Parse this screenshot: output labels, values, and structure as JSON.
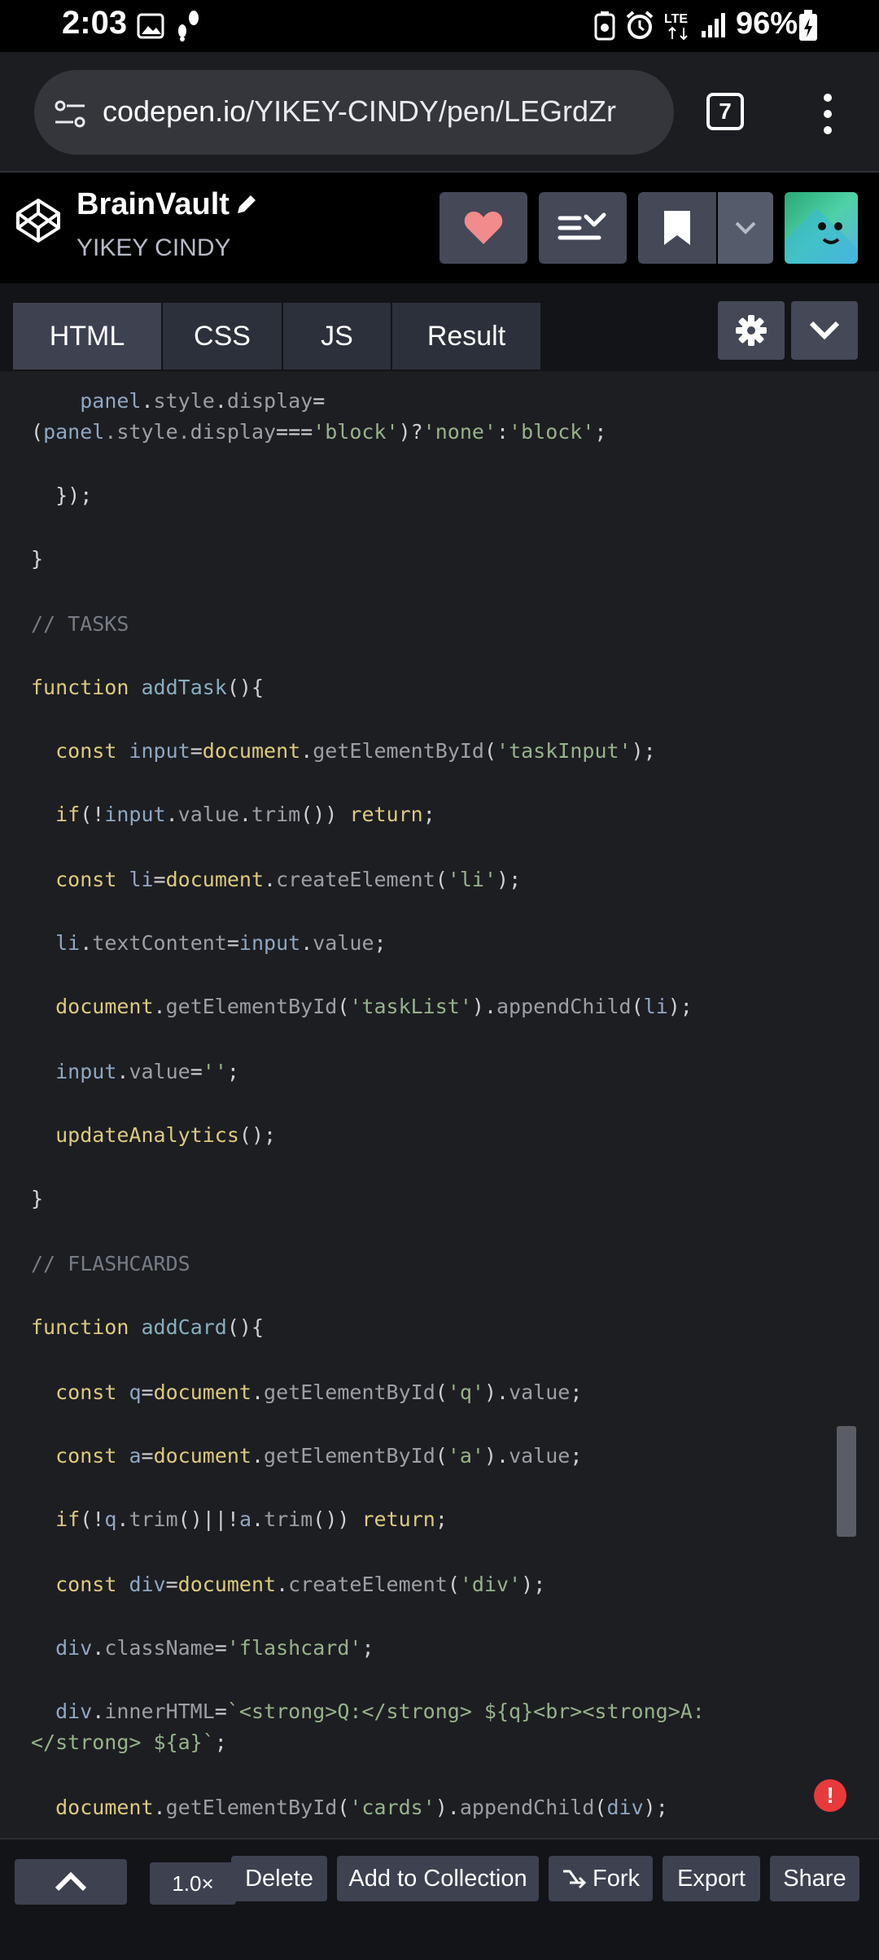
{
  "status_bar": {
    "time": "2:03",
    "battery": "96%"
  },
  "browser": {
    "url_host": "codepen.io",
    "url_path": "/YIKEY-CINDY/pen/LEGrdZr",
    "tab_count": "7"
  },
  "pen": {
    "title": "BrainVault",
    "author": "YIKEY CINDY"
  },
  "editor_tabs": [
    "HTML",
    "CSS",
    "JS",
    "Result"
  ],
  "code": {
    "l1_panel": "panel",
    "l1_dot": ".",
    "l1_style": "style",
    "l1_dot2": ".",
    "l1_display": "display",
    "l1_eq": "=",
    "l2_open": "(",
    "l2_panel": "panel",
    "l2_style": ".style.display",
    "l2_eq": "===",
    "l2_block": "'block'",
    "l2_q": ")?",
    "l2_none": "'none'",
    "l2_colon": ":",
    "l2_block2": "'block'",
    "l2_end": ";",
    "l3": "  });",
    "l4": "}",
    "l5": "// TASKS",
    "l6_kw": "function",
    "l6_fn": "addTask",
    "l6_end": "(){",
    "l7_kw": "const",
    "l7_var": "input",
    "l7_eq": "=",
    "l7_doc": "document",
    "l7_dot": ".",
    "l7_m": "getElementById",
    "l7_open": "(",
    "l7_str": "'taskInput'",
    "l7_end": ");",
    "l8_kw": "if",
    "l8_a": "(!",
    "l8_var": "input",
    "l8_dot": ".",
    "l8_p": "value",
    "l8_dot2": ".",
    "l8_m": "trim",
    "l8_b": "()) ",
    "l8_ret": "return",
    "l8_end": ";",
    "l9_kw": "const",
    "l9_var": "li",
    "l9_eq": "=",
    "l9_doc": "document",
    "l9_dot": ".",
    "l9_m": "createElement",
    "l9_open": "(",
    "l9_str": "'li'",
    "l9_end": ");",
    "l10_var": "li",
    "l10_dot": ".",
    "l10_p": "textContent",
    "l10_eq": "=",
    "l10_var2": "input",
    "l10_dot2": ".",
    "l10_p2": "value",
    "l10_end": ";",
    "l11_doc": "document",
    "l11_dot": ".",
    "l11_m": "getElementById",
    "l11_open": "(",
    "l11_str": "'taskList'",
    "l11_close": ").",
    "l11_m2": "appendChild",
    "l11_open2": "(",
    "l11_var": "li",
    "l11_end": ");",
    "l12_var": "input",
    "l12_dot": ".",
    "l12_p": "value",
    "l12_eq": "=",
    "l12_str": "''",
    "l12_end": ";",
    "l13_fn": "updateAnalytics",
    "l13_end": "();",
    "l14": "}",
    "l15": "// FLASHCARDS",
    "l16_kw": "function",
    "l16_fn": "addCard",
    "l16_end": "(){",
    "l17_kw": "const",
    "l17_var": "q",
    "l17_eq": "=",
    "l17_doc": "document",
    "l17_dot": ".",
    "l17_m": "getElementById",
    "l17_open": "(",
    "l17_str": "'q'",
    "l17_close": ").",
    "l17_p": "value",
    "l17_end": ";",
    "l18_kw": "const",
    "l18_var": "a",
    "l18_eq": "=",
    "l18_doc": "document",
    "l18_dot": ".",
    "l18_m": "getElementById",
    "l18_open": "(",
    "l18_str": "'a'",
    "l18_close": ").",
    "l18_p": "value",
    "l18_end": ";",
    "l19_kw": "if",
    "l19_a": "(!",
    "l19_var": "q",
    "l19_dot": ".",
    "l19_m": "trim",
    "l19_b": "()||!",
    "l19_var2": "a",
    "l19_dot2": ".",
    "l19_m2": "trim",
    "l19_c": "()) ",
    "l19_ret": "return",
    "l19_end": ";",
    "l20_kw": "const",
    "l20_var": "div",
    "l20_eq": "=",
    "l20_doc": "document",
    "l20_dot": ".",
    "l20_m": "createElement",
    "l20_open": "(",
    "l20_str": "'div'",
    "l20_end": ");",
    "l21_var": "div",
    "l21_dot": ".",
    "l21_p": "className",
    "l21_eq": "=",
    "l21_str": "'flashcard'",
    "l21_end": ";",
    "l22_var": "div",
    "l22_dot": ".",
    "l22_p": "innerHTML",
    "l22_eq": "=",
    "l22_str": "`<strong>Q:</strong> ${q}<br><strong>A:",
    "l23_str": "</strong> ${a}`",
    "l23_end": ";",
    "l24_doc": "document",
    "l24_dot": ".",
    "l24_m": "getElementById",
    "l24_open": "(",
    "l24_str": "'cards'",
    "l24_close": ").",
    "l24_m2": "appendChild",
    "l24_open2": "(",
    "l24_var": "div",
    "l24_end": ");"
  },
  "error_badge": "!",
  "bottom_bar": {
    "zoom": "1.0×",
    "delete": "Delete",
    "add_to_collection": "Add to Collection",
    "fork": "Fork",
    "export": "Export",
    "share": "Share"
  }
}
